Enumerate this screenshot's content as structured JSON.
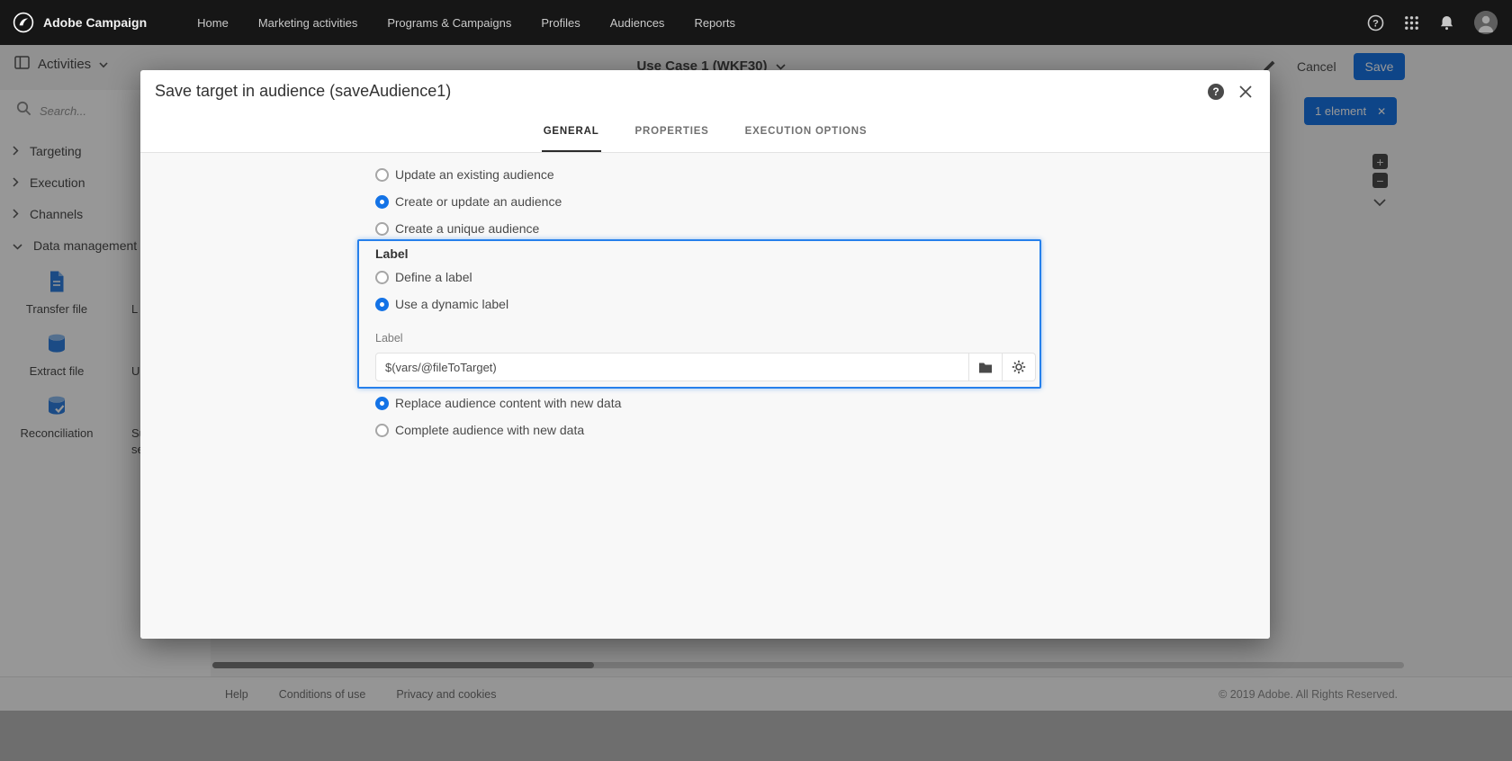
{
  "icons": {
    "zoom_in": "+",
    "zoom_out": "−",
    "close": "✕"
  },
  "topbar": {
    "brand": "Adobe Campaign",
    "nav": [
      {
        "label": "Home"
      },
      {
        "label": "Marketing activities"
      },
      {
        "label": "Programs & Campaigns"
      },
      {
        "label": "Profiles"
      },
      {
        "label": "Audiences"
      },
      {
        "label": "Reports"
      }
    ]
  },
  "workspace": {
    "activities_label": "Activities",
    "search_placeholder": "Search...",
    "sections": [
      {
        "label": "Targeting"
      },
      {
        "label": "Execution"
      },
      {
        "label": "Channels"
      },
      {
        "label": "Data management (ETL)"
      }
    ],
    "palette_col1": [
      {
        "label": "Transfer file"
      },
      {
        "label": "Extract file"
      },
      {
        "label": "Reconciliation"
      }
    ],
    "palette_col2": [
      {
        "label": "L"
      },
      {
        "label": "Up"
      },
      {
        "label": "Sub-\nse"
      }
    ],
    "title": "Use Case 1 (WKF30)",
    "cancel_label": "Cancel",
    "save_label": "Save",
    "element_badge": "1 element",
    "footer": {
      "links": [
        {
          "label": "Help"
        },
        {
          "label": "Conditions of use"
        },
        {
          "label": "Privacy and cookies"
        }
      ],
      "copyright": "© 2019 Adobe. All Rights Reserved."
    }
  },
  "modal": {
    "title": "Save target in audience (saveAudience1)",
    "tabs": [
      {
        "label": "GENERAL",
        "active": true
      },
      {
        "label": "PROPERTIES",
        "active": false
      },
      {
        "label": "EXECUTION OPTIONS",
        "active": false
      }
    ],
    "audience_mode_options": [
      {
        "label": "Update an existing audience",
        "selected": false
      },
      {
        "label": "Create or update an audience",
        "selected": true
      },
      {
        "label": "Create a unique audience",
        "selected": false
      }
    ],
    "label_section": {
      "heading": "Label",
      "options": [
        {
          "label": "Define a label",
          "selected": false
        },
        {
          "label": "Use a dynamic label",
          "selected": true
        }
      ],
      "field_label": "Label",
      "field_value": "$(vars/@fileToTarget)"
    },
    "content_mode_options": [
      {
        "label": "Replace audience content with new data",
        "selected": true
      },
      {
        "label": "Complete audience with new data",
        "selected": false
      }
    ]
  }
}
